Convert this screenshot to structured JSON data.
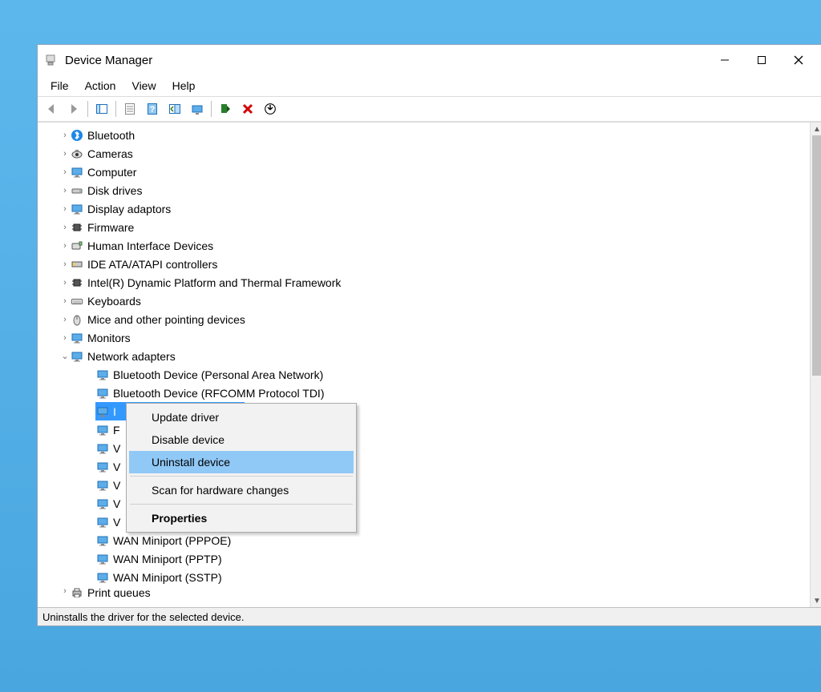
{
  "window": {
    "title": "Device Manager"
  },
  "menu": {
    "file": "File",
    "action": "Action",
    "view": "View",
    "help": "Help"
  },
  "tree": {
    "items": [
      {
        "label": "Bluetooth",
        "expanded": false,
        "icon": "bluetooth"
      },
      {
        "label": "Cameras",
        "expanded": false,
        "icon": "camera"
      },
      {
        "label": "Computer",
        "expanded": false,
        "icon": "monitor"
      },
      {
        "label": "Disk drives",
        "expanded": false,
        "icon": "disk"
      },
      {
        "label": "Display adaptors",
        "expanded": false,
        "icon": "display"
      },
      {
        "label": "Firmware",
        "expanded": false,
        "icon": "chip"
      },
      {
        "label": "Human Interface Devices",
        "expanded": false,
        "icon": "hid"
      },
      {
        "label": "IDE ATA/ATAPI controllers",
        "expanded": false,
        "icon": "ide"
      },
      {
        "label": "Intel(R) Dynamic Platform and Thermal Framework",
        "expanded": false,
        "icon": "chip2"
      },
      {
        "label": "Keyboards",
        "expanded": false,
        "icon": "keyboard"
      },
      {
        "label": "Mice and other pointing devices",
        "expanded": false,
        "icon": "mouse"
      },
      {
        "label": "Monitors",
        "expanded": false,
        "icon": "monitor2"
      },
      {
        "label": "Network adapters",
        "expanded": true,
        "icon": "network",
        "children": [
          {
            "label": "Bluetooth Device (Personal Area Network)"
          },
          {
            "label": "Bluetooth Device (RFCOMM Protocol TDI)"
          },
          {
            "label": "I",
            "selected": true
          },
          {
            "label": "F"
          },
          {
            "label": "V"
          },
          {
            "label": "V"
          },
          {
            "label": "V"
          },
          {
            "label": "V"
          },
          {
            "label": "V"
          },
          {
            "label": "WAN Miniport (PPPOE)"
          },
          {
            "label": "WAN Miniport (PPTP)"
          },
          {
            "label": "WAN Miniport (SSTP)"
          }
        ]
      },
      {
        "label": "Print queues",
        "expanded": false,
        "icon": "printer",
        "cut": true
      }
    ]
  },
  "context_menu": {
    "update": "Update driver",
    "disable": "Disable device",
    "uninstall": "Uninstall device",
    "scan": "Scan for hardware changes",
    "properties": "Properties"
  },
  "statusbar": {
    "text": "Uninstalls the driver for the selected device."
  }
}
